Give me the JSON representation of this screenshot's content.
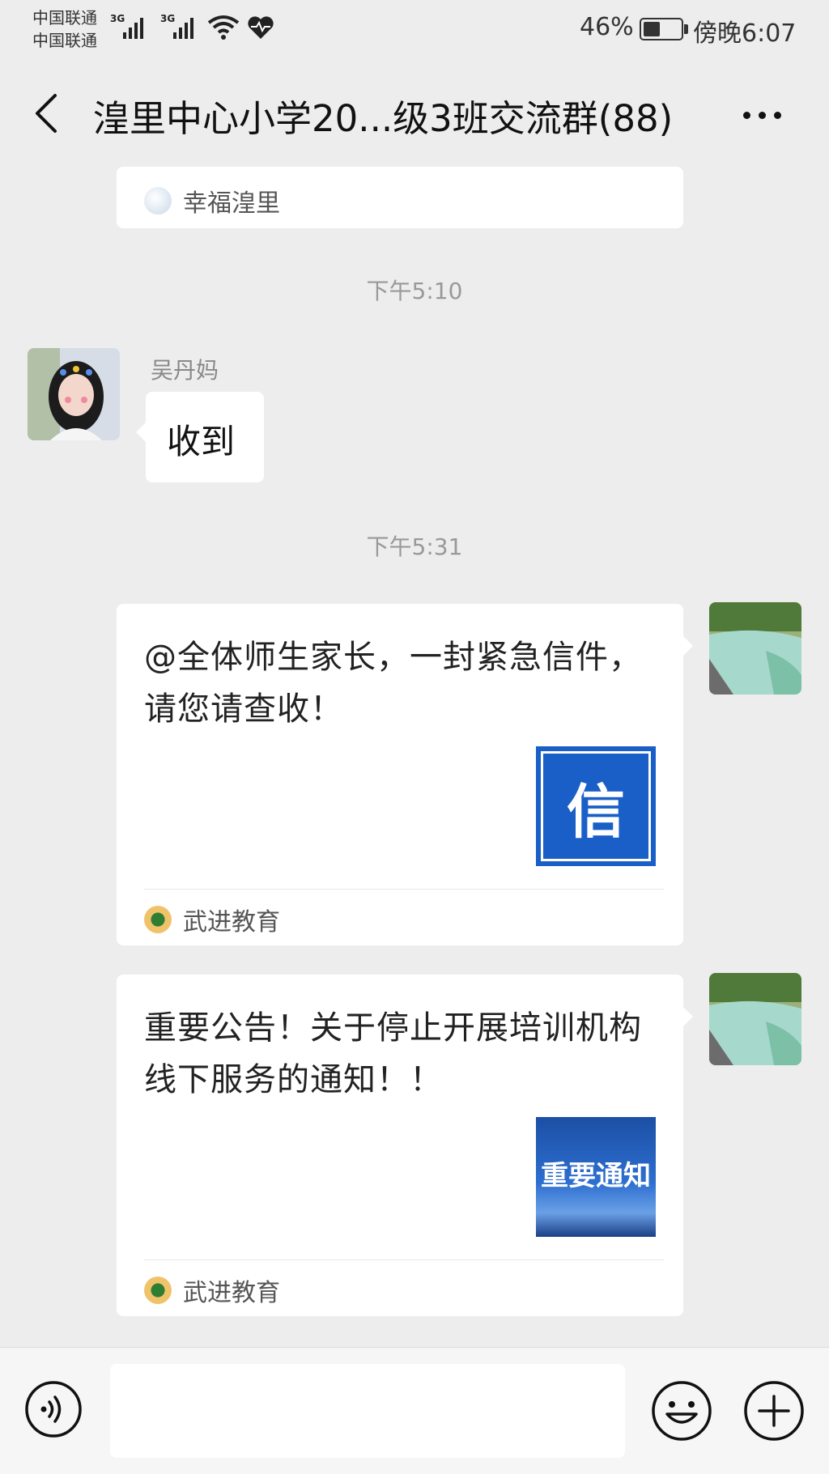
{
  "status_bar": {
    "carrier1": "中国联通",
    "carrier2": "中国联通",
    "sig1": "3G",
    "sig2": "3G",
    "battery": "46%",
    "battery_level": 0.46,
    "time": "傍晚6:07",
    "icons": [
      "signal-icon",
      "wifi-icon",
      "health-heart-icon",
      "battery-icon"
    ]
  },
  "header": {
    "title": "湟里中心小学20...级3班交流群(88)",
    "icons": [
      "back-chevron-icon",
      "more-dots-icon"
    ]
  },
  "messages": {
    "top_card": {
      "source": "幸福湟里"
    },
    "time1": "下午5:10",
    "text_msg": {
      "sender": "吴丹妈",
      "text": "收到"
    },
    "time2": "下午5:31",
    "link1": {
      "title": "@全体师生家长，一封紧急信件，请您请查收！",
      "thumb_text": "信",
      "source": "武进教育"
    },
    "link2": {
      "title": "重要公告！关于停止开展培训机构线下服务的通知！！",
      "thumb_text": "重要通知",
      "source": "武进教育"
    }
  },
  "bottom": {
    "icons": [
      "voice-icon",
      "emoji-icon",
      "plus-icon"
    ]
  },
  "colors": {
    "background": "#ededed",
    "bubble": "#ffffff",
    "link_thumb_blue": "#1a5fc7",
    "timestamp": "#999999"
  }
}
